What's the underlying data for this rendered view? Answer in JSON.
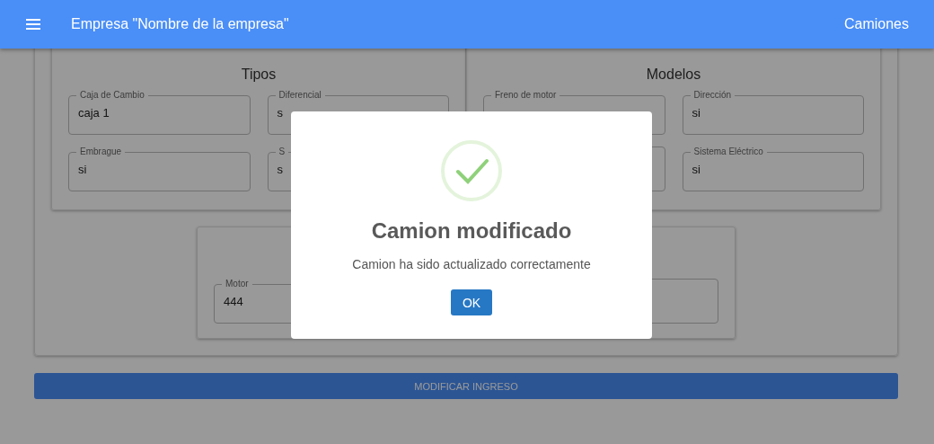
{
  "header": {
    "title": "Empresa \"Nombre de la empresa\"",
    "link": "Camiones"
  },
  "sections": [
    {
      "title": "Tipos",
      "fields": [
        {
          "kind": "outlined",
          "label": "Caja de Cambio",
          "value": "caja 1"
        },
        {
          "kind": "outlined",
          "label": "Diferencial",
          "value": "s"
        },
        {
          "kind": "outlined",
          "label": "Embrague",
          "value": "si"
        },
        {
          "kind": "outlined",
          "label": "S",
          "value": "s"
        }
      ]
    },
    {
      "title": "Modelos",
      "fields": [
        {
          "kind": "outlined",
          "label": "Freno de motor"
        },
        {
          "kind": "outlined",
          "label": "Dirección",
          "value": "si"
        },
        {
          "kind": "outlined"
        },
        {
          "kind": "outlined",
          "label": "Sistema Eléctrico",
          "value": "si"
        }
      ]
    }
  ],
  "bottom_fields": [
    {
      "kind": "outlined",
      "label": "Motor",
      "value": "444"
    },
    {
      "kind": "outlined"
    }
  ],
  "submit_button": "MODIFICAR INGRESO",
  "dialog": {
    "title": "Camion modificado",
    "message": "Camion ha sido actualizado correctamente",
    "button": "OK"
  }
}
